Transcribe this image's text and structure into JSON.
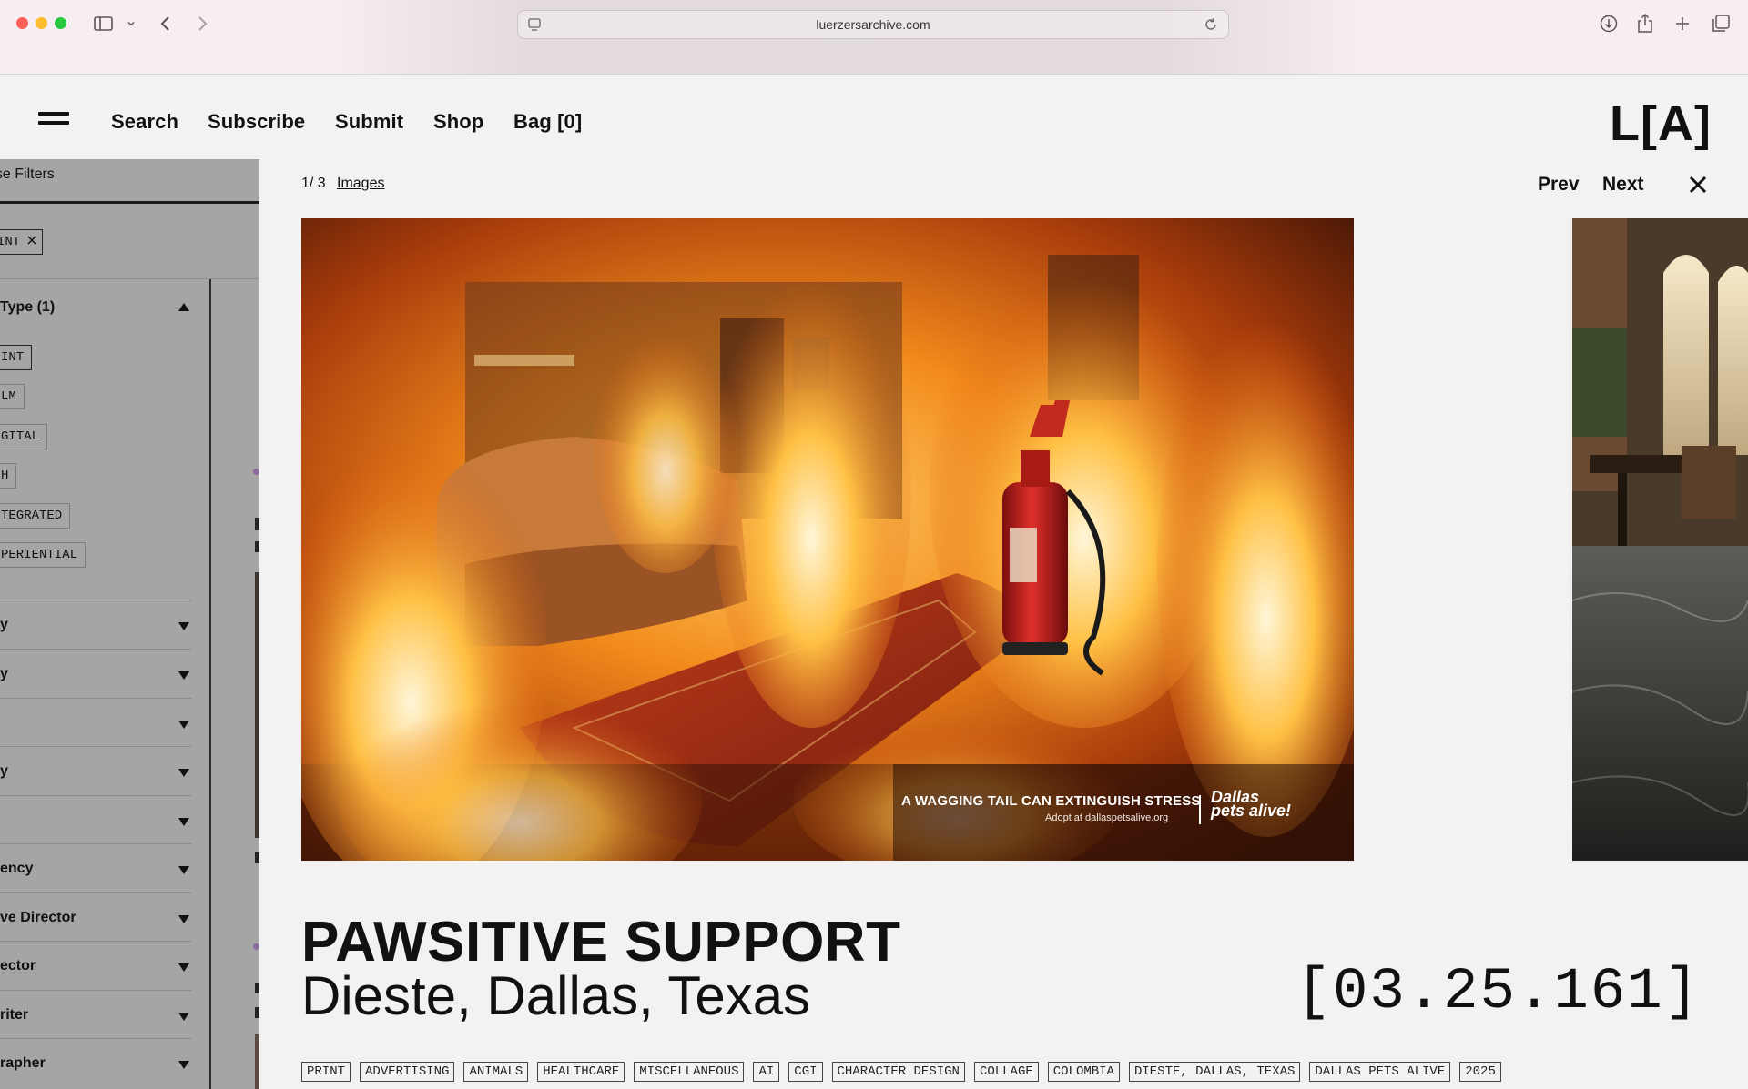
{
  "browser": {
    "url": "luerzersarchive.com"
  },
  "header": {
    "nav": [
      "Search",
      "Subscribe",
      "Submit",
      "Shop",
      "Bag [0]"
    ],
    "logo": "L[A]"
  },
  "sidebar": {
    "close_filters": "ose Filters",
    "active_filter": "INT",
    "type_heading": "Type (1)",
    "type_options": [
      "INT",
      "LM",
      "GITAL",
      "H",
      "TEGRATED",
      "PERIENTIAL"
    ],
    "filters": [
      "y",
      "y",
      "",
      "y",
      "",
      "ency",
      "ve Director",
      "ector",
      "riter",
      "rapher"
    ]
  },
  "viewer": {
    "counter": "1/ 3",
    "images_link": "Images",
    "prev": "Prev",
    "next": "Next",
    "ad": {
      "tagline": "A WAGGING TAIL CAN EXTINGUISH STRESS",
      "adopt": "Adopt at dallaspetsalive.org",
      "logo_line1": "Dallas",
      "logo_line2": "pets alive!"
    }
  },
  "entry": {
    "title": "PAWSITIVE SUPPORT",
    "subtitle": "Dieste, Dallas, Texas",
    "ref": "[03.25.161]",
    "tags": [
      "PRINT",
      "ADVERTISING",
      "ANIMALS",
      "HEALTHCARE",
      "MISCELLANEOUS",
      "AI",
      "CGI",
      "CHARACTER DESIGN",
      "COLLAGE",
      "COLOMBIA",
      "DIESTE, DALLAS, TEXAS",
      "DALLAS PETS ALIVE",
      "2025"
    ]
  },
  "colors": {
    "page_bg": "#f2f2f2",
    "sidebar_bg": "#a5a5a5",
    "text": "#111111"
  }
}
